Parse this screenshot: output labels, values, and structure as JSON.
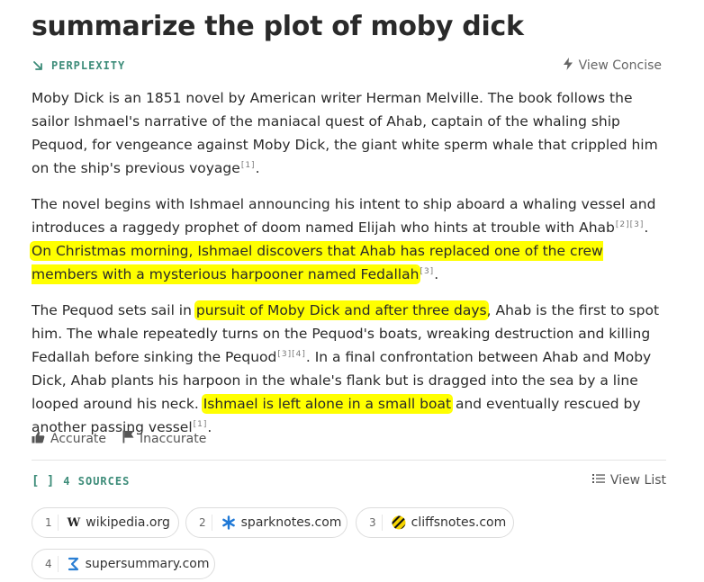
{
  "title": "summarize the plot of moby dick",
  "brand": {
    "name": "PERPLEXITY",
    "icon": "arrow-down-right-icon",
    "color": "#3d8c79"
  },
  "view_concise": {
    "label": "View Concise",
    "icon": "lightning-icon"
  },
  "answer": {
    "p1": {
      "text": "Moby Dick is an 1851 novel by American writer Herman Melville. The book follows the sailor Ishmael's narrative of the maniacal quest of Ahab, captain of the whaling ship Pequod, for vengeance against Moby Dick, the giant white sperm whale that crippled him on the ship's previous voyage",
      "cite": "[1]",
      "end": "."
    },
    "p2": {
      "a": "The novel begins with Ishmael announcing his intent to ship aboard a whaling vessel and introduces a raggedy prophet of doom named Elijah who hints at trouble with Ahab",
      "cite1": "[2][3]",
      "b": ". ",
      "hl": "On Christmas morning, Ishmael discovers that Ahab has replaced one of the crew members with a mysterious harpooner named Fedallah",
      "cite2": "[3]",
      "end": "."
    },
    "p3": {
      "a": "The Pequod sets sail in ",
      "hl1": "pursuit of Moby Dick and after three days",
      "b": ", Ahab is the first to spot him. The whale repeatedly turns on the Pequod's boats, wreaking destruction and killing Fedallah before sinking the Pequod",
      "cite1": "[3][4]",
      "c": ". In a final confrontation between Ahab and Moby Dick, Ahab plants his harpoon in the whale's flank but is dragged into the sea by a line looped around his neck. ",
      "hl2": "Ishmael is left alone in a small boat",
      "d": " and eventually rescued by another passing vessel",
      "cite2": "[1]",
      "end": "."
    },
    "highlight_color": "#ffff00"
  },
  "feedback": {
    "accurate": "Accurate",
    "inaccurate": "Inaccurate"
  },
  "sources": {
    "bracket": "[ ]",
    "label": "4 SOURCES",
    "view_list": "View List",
    "items": [
      {
        "num": "1",
        "name": "wikipedia.org",
        "icon": "wikipedia-icon",
        "glyph": "W"
      },
      {
        "num": "2",
        "name": "sparknotes.com",
        "icon": "sparknotes-icon"
      },
      {
        "num": "3",
        "name": "cliffsnotes.com",
        "icon": "cliffsnotes-icon"
      },
      {
        "num": "4",
        "name": "supersummary.com",
        "icon": "supersummary-icon"
      }
    ]
  }
}
